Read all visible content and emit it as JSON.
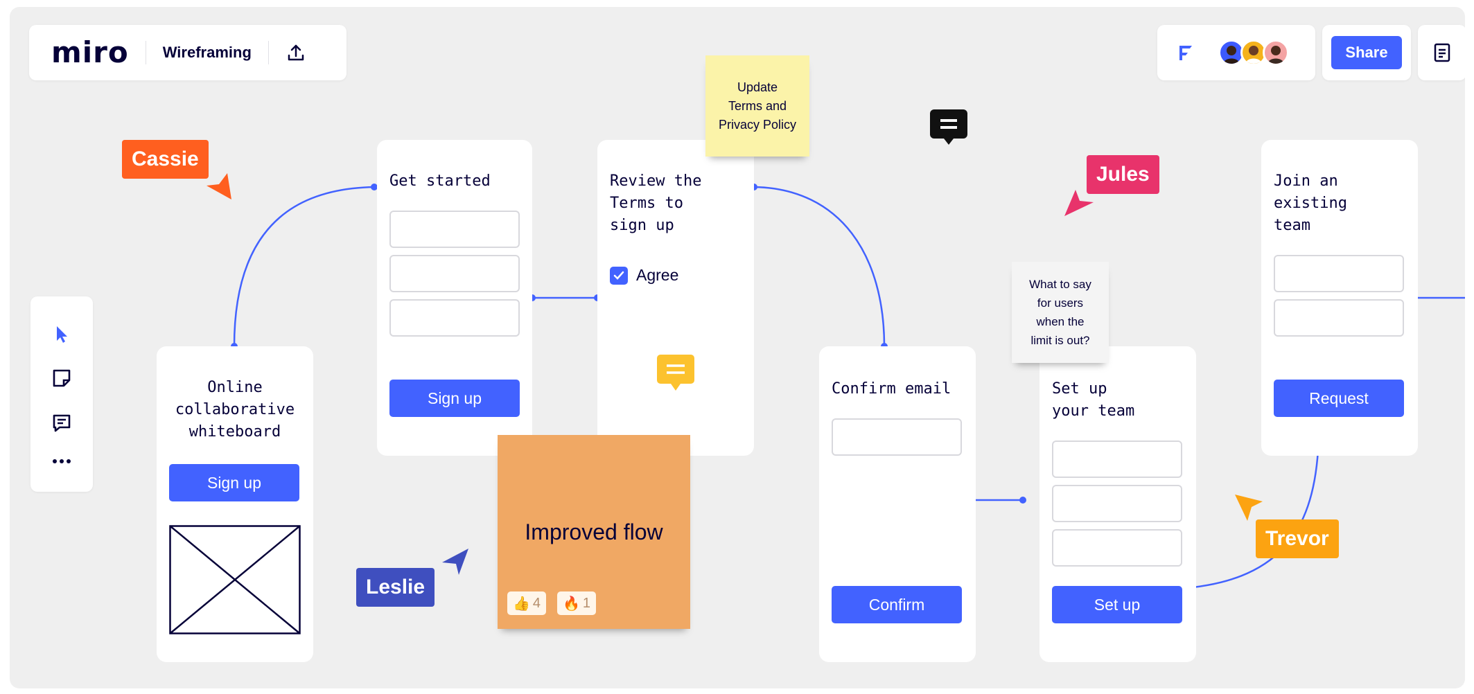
{
  "app": {
    "logo": "miro",
    "board_title": "Wireframing",
    "share_label": "Share",
    "accent_color": "#4262ff"
  },
  "collaborators": {
    "avatar_colors": [
      "#3d5afe",
      "#f5b21c",
      "#f4a3a3"
    ]
  },
  "toolbar": {
    "items": [
      "select-cursor-icon",
      "sticky-note-icon",
      "comment-icon",
      "more-icon"
    ]
  },
  "cards": {
    "landing": {
      "title": "Online\ncollaborative\nwhiteboard",
      "button": "Sign up"
    },
    "get_started": {
      "title": "Get started",
      "button": "Sign up"
    },
    "review_terms": {
      "title": "Review the\nTerms to\nsign up",
      "checkbox_label": "Agree"
    },
    "confirm_email": {
      "title": "Confirm email",
      "button": "Confirm"
    },
    "setup_team": {
      "title": "Set up\nyour team",
      "button": "Set up"
    },
    "join_team": {
      "title": "Join an\nexisting\nteam",
      "button": "Request"
    }
  },
  "stickies": {
    "terms": "Update\nTerms and\nPrivacy Policy",
    "limit": "What to say\nfor users\nwhen the\nlimit is out?",
    "improved_flow": "Improved flow",
    "reactions": [
      {
        "emoji": "👍",
        "count": "4"
      },
      {
        "emoji": "🔥",
        "count": "1"
      }
    ]
  },
  "cursors": [
    {
      "name": "Cassie",
      "color": "#ff5f1f"
    },
    {
      "name": "Jules",
      "color": "#e8336b"
    },
    {
      "name": "Leslie",
      "color": "#3f4fbf"
    },
    {
      "name": "Trevor",
      "color": "#fca311"
    }
  ]
}
